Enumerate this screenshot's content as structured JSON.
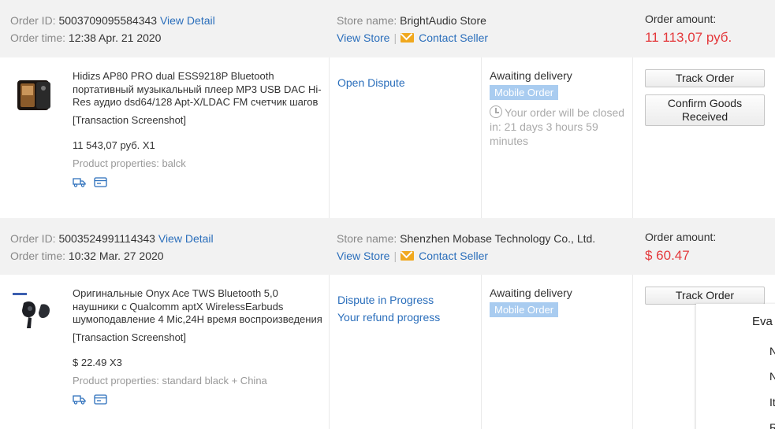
{
  "orders": [
    {
      "order_id_label": "Order ID:",
      "order_id": "5003709095584343",
      "view_detail": "View Detail",
      "order_time_label": "Order time:",
      "order_time": "12:38 Apr. 21 2020",
      "store_label": "Store name:",
      "store_name": "BrightAudio Store",
      "view_store": "View Store",
      "separator": "|",
      "contact_seller": "Contact Seller",
      "amount_label": "Order amount:",
      "amount": "11 113,07 руб.",
      "product_title": "Hidizs AP80 PRO dual ESS9218P Bluetooth портативный музыкальный плеер MP3 USB DAC Hi-Res аудио dsd64/128 Apt-X/LDAC FM счетчик шагов",
      "transaction_screenshot": "[Transaction Screenshot]",
      "price_qty": "11 543,07 руб. X1",
      "properties": "Product properties: balck",
      "dispute_links": [
        "Open Dispute"
      ],
      "status": "Awaiting delivery",
      "badge": "Mobile Order",
      "closing_note": "Your order will be closed in: 21 days 3 hours 59 minutes",
      "buttons": [
        "Track Order",
        "Confirm Goods Received"
      ]
    },
    {
      "order_id_label": "Order ID:",
      "order_id": "5003524991114343",
      "view_detail": "View Detail",
      "order_time_label": "Order time:",
      "order_time": "10:32 Mar. 27 2020",
      "store_label": "Store name:",
      "store_name": "Shenzhen Mobase Technology Co., Ltd.",
      "view_store": "View Store",
      "separator": "|",
      "contact_seller": "Contact Seller",
      "amount_label": "Order amount:",
      "amount": "$ 60.47",
      "product_title": "Оригинальные Onyx Ace TWS Bluetooth 5,0 наушники с Qualcomm aptX WirelessEarbuds шумоподавление 4 Mic,24H время воспроизведения",
      "transaction_screenshot": "[Transaction Screenshot]",
      "price_qty": "$ 22.49 X3",
      "properties": "Product properties: standard black + China",
      "dispute_links": [
        "Dispute in Progress",
        "Your refund progress"
      ],
      "status": "Awaiting delivery",
      "badge": "Mobile Order",
      "buttons": [
        "Track Order"
      ]
    }
  ],
  "overlay": {
    "title": "Eva",
    "chars": [
      "N",
      "N",
      "It",
      "R"
    ]
  },
  "colors": {
    "link": "#2a6ebb",
    "amount": "#e4393c",
    "header_bg": "#f2f2f2",
    "badge_bg": "#a9ccf0",
    "mail_icon": "#f0a81e"
  }
}
